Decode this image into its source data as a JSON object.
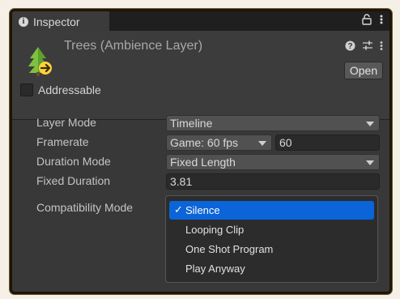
{
  "tab": {
    "title": "Inspector"
  },
  "asset": {
    "title": "Trees (Ambience Layer)",
    "open_label": "Open"
  },
  "addressable": {
    "label": "Addressable",
    "checked": false
  },
  "fields": {
    "layer_mode": {
      "label": "Layer Mode",
      "value": "Timeline"
    },
    "framerate": {
      "label": "Framerate",
      "value": "Game: 60 fps",
      "number": "60"
    },
    "duration_mode": {
      "label": "Duration Mode",
      "value": "Fixed Length"
    },
    "fixed_duration": {
      "label": "Fixed Duration",
      "value": "3.81"
    },
    "compatibility_mode": {
      "label": "Compatibility Mode"
    }
  },
  "menu": {
    "items": [
      {
        "label": "Silence",
        "selected": true
      },
      {
        "label": "Looping Clip",
        "selected": false
      },
      {
        "label": "One Shot Program",
        "selected": false
      },
      {
        "label": "Play Anyway",
        "selected": false
      }
    ],
    "check_glyph": "✓"
  },
  "colors": {
    "panel": "#383838",
    "selection": "#0b64d8",
    "frame_border": "#1f1506"
  }
}
